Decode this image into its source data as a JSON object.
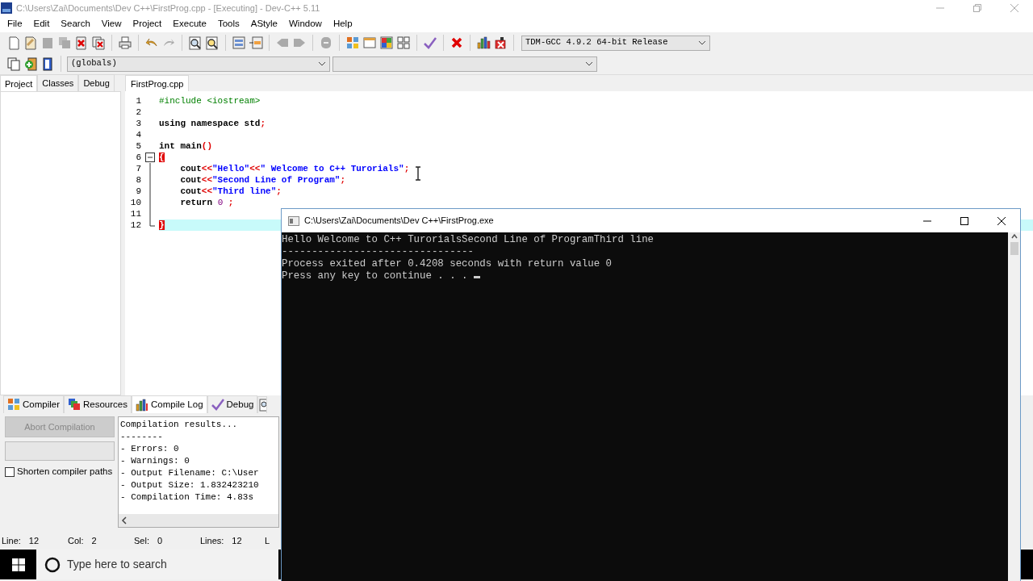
{
  "window": {
    "title": "C:\\Users\\Zai\\Documents\\Dev C++\\FirstProg.cpp - [Executing] - Dev-C++ 5.11"
  },
  "menu": [
    "File",
    "Edit",
    "Search",
    "View",
    "Project",
    "Execute",
    "Tools",
    "AStyle",
    "Window",
    "Help"
  ],
  "compiler_select": {
    "value": "TDM-GCC 4.9.2 64-bit Release"
  },
  "scope_select": {
    "value": "(globals)"
  },
  "side_tabs": [
    {
      "label": "Project",
      "selected": true
    },
    {
      "label": "Classes",
      "selected": false
    },
    {
      "label": "Debug",
      "selected": false
    }
  ],
  "editor_tabs": [
    {
      "label": "FirstProg.cpp",
      "selected": true
    }
  ],
  "code_lines": [
    {
      "number": "1",
      "tokens": [
        {
          "kind": "preprocessor",
          "text": "#include <iostream>"
        }
      ]
    },
    {
      "number": "2"
    },
    {
      "number": "3",
      "tokens": [
        {
          "kind": "plain",
          "text": "using namespace std"
        },
        {
          "kind": "symbol",
          "text": ";"
        }
      ]
    },
    {
      "number": "4"
    },
    {
      "number": "5",
      "tokens": [
        {
          "kind": "plain",
          "text": "int main"
        },
        {
          "kind": "symbol",
          "text": "()"
        }
      ]
    },
    {
      "number": "6",
      "fold_start": true,
      "tokens": [
        {
          "kind": "brace",
          "text": "{"
        }
      ]
    },
    {
      "number": "7",
      "tokens": [
        {
          "kind": "plain",
          "text": "    cout"
        },
        {
          "kind": "symbol",
          "text": "<<"
        },
        {
          "kind": "string",
          "text": "\"Hello\""
        },
        {
          "kind": "symbol",
          "text": "<<"
        },
        {
          "kind": "string",
          "text": "\" Welcome to C++ Turorials\""
        },
        {
          "kind": "symbol",
          "text": ";"
        }
      ]
    },
    {
      "number": "8",
      "tokens": [
        {
          "kind": "plain",
          "text": "    cout"
        },
        {
          "kind": "symbol",
          "text": "<<"
        },
        {
          "kind": "string",
          "text": "\"Second Line of Program\""
        },
        {
          "kind": "symbol",
          "text": ";"
        }
      ]
    },
    {
      "number": "9",
      "tokens": [
        {
          "kind": "plain",
          "text": "    cout"
        },
        {
          "kind": "symbol",
          "text": "<<"
        },
        {
          "kind": "string",
          "text": "\"Third line\""
        },
        {
          "kind": "symbol",
          "text": ";"
        }
      ]
    },
    {
      "number": "10",
      "tokens": [
        {
          "kind": "plain",
          "text": "    return "
        },
        {
          "kind": "number",
          "text": "0"
        },
        {
          "kind": "symbol",
          "text": " ;"
        }
      ]
    },
    {
      "number": "11"
    },
    {
      "number": "12",
      "fold_end": true,
      "current": true,
      "tokens": [
        {
          "kind": "brace",
          "text": "}"
        }
      ]
    }
  ],
  "bottom_tabs": [
    {
      "label": "Compiler",
      "selected": false
    },
    {
      "label": "Resources",
      "selected": false
    },
    {
      "label": "Compile Log",
      "selected": true
    },
    {
      "label": "Debug",
      "selected": false
    }
  ],
  "abort_button": {
    "label": "Abort Compilation",
    "disabled": true
  },
  "progress": {
    "level": 0
  },
  "shorten_paths": {
    "label": "Shorten compiler paths",
    "checked": false
  },
  "compile_log": [
    "Compilation results...",
    "--------",
    "- Errors: 0",
    "- Warnings: 0",
    "- Output Filename: C:\\User",
    "- Output Size: 1.832423210",
    "- Compilation Time: 4.83s"
  ],
  "status_bar": [
    {
      "label": "Line:",
      "value": "12"
    },
    {
      "label": "Col:",
      "value": "2"
    },
    {
      "label": "Sel:",
      "value": "0"
    },
    {
      "label": "Lines:",
      "value": "12"
    },
    {
      "label": "L"
    }
  ],
  "taskbar": {
    "search_placeholder": "Type here to search"
  },
  "console": {
    "title": "C:\\Users\\Zai\\Documents\\Dev C++\\FirstProg.exe",
    "lines": [
      "Hello Welcome to C++ TurorialsSecond Line of ProgramThird line",
      "--------------------------------",
      "Process exited after 0.4208 seconds with return value 0",
      "Press any key to continue . . . "
    ]
  }
}
